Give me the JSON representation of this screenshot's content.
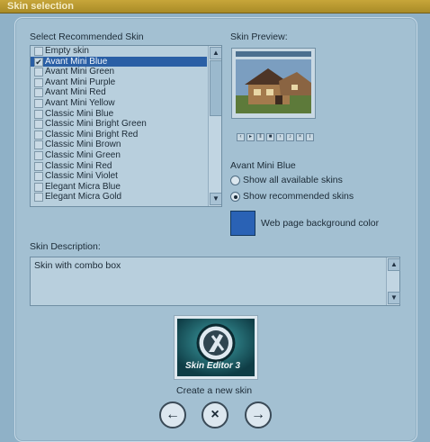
{
  "window": {
    "title": "Skin selection"
  },
  "skin_list": {
    "label": "Select Recommended Skin",
    "items": [
      {
        "name": "Empty skin",
        "checked": false,
        "selected": false
      },
      {
        "name": "Avant Mini Blue",
        "checked": true,
        "selected": true
      },
      {
        "name": "Avant Mini Green",
        "checked": false,
        "selected": false
      },
      {
        "name": "Avant Mini Purple",
        "checked": false,
        "selected": false
      },
      {
        "name": "Avant Mini Red",
        "checked": false,
        "selected": false
      },
      {
        "name": "Avant Mini Yellow",
        "checked": false,
        "selected": false
      },
      {
        "name": "Classic Mini Blue",
        "checked": false,
        "selected": false
      },
      {
        "name": "Classic Mini Bright Green",
        "checked": false,
        "selected": false
      },
      {
        "name": "Classic Mini Bright Red",
        "checked": false,
        "selected": false
      },
      {
        "name": "Classic Mini Brown",
        "checked": false,
        "selected": false
      },
      {
        "name": "Classic Mini Green",
        "checked": false,
        "selected": false
      },
      {
        "name": "Classic Mini Red",
        "checked": false,
        "selected": false
      },
      {
        "name": "Classic Mini Violet",
        "checked": false,
        "selected": false
      },
      {
        "name": "Elegant Micra Blue",
        "checked": false,
        "selected": false
      },
      {
        "name": "Elegant Micra Gold",
        "checked": false,
        "selected": false
      }
    ]
  },
  "preview": {
    "label": "Skin Preview:",
    "skin_name": "Avant Mini Blue"
  },
  "skin_filter": {
    "show_all_label": "Show all available skins",
    "show_recommended_label": "Show recommended skins",
    "selected": "recommended"
  },
  "background": {
    "label": "Web page background color",
    "color": "#2a62b5"
  },
  "description": {
    "label": "Skin Description:",
    "text": "Skin with combo box"
  },
  "logo": {
    "title": "Skin Editor 3",
    "caption": "Create a new skin"
  },
  "nav": {
    "back_icon": "arrow-left-icon",
    "cancel_icon": "close-icon",
    "next_icon": "arrow-right-icon"
  }
}
